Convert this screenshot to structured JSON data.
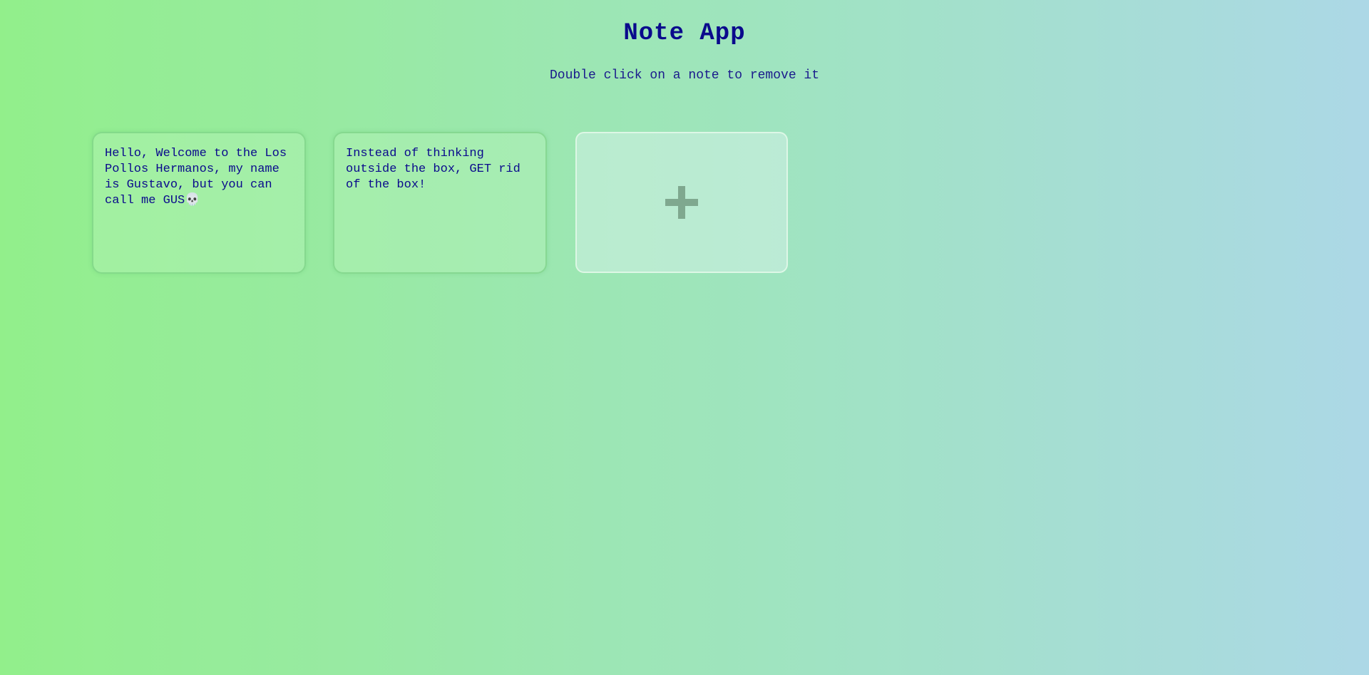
{
  "app": {
    "title": "Note App",
    "subtitle": "Double click on a note to remove it"
  },
  "notes": [
    {
      "text": "Hello, Welcome to the Los Pollos Hermanos, my name is Gustavo, but you can call me GUS💀"
    },
    {
      "text": "Instead of thinking outside the box, GET rid of the box!"
    }
  ],
  "add_button": {
    "icon": "plus-icon"
  }
}
